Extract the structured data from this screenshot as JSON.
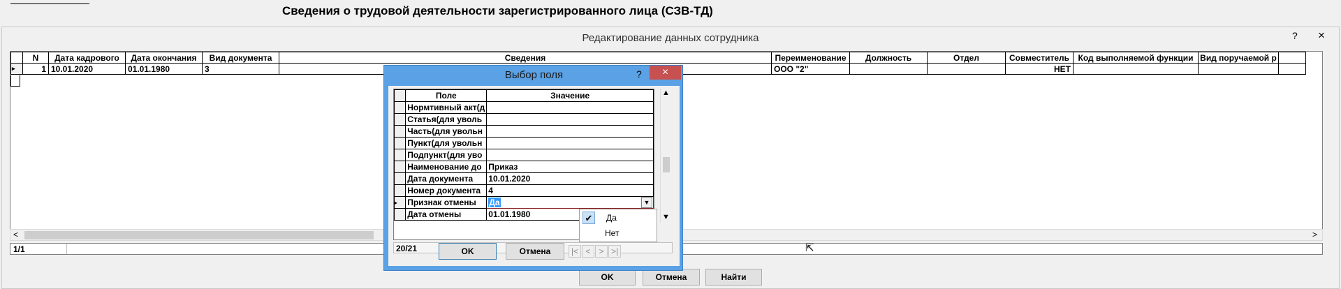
{
  "header": {
    "title": "Сведения о трудовой деятельности зарегистрированного лица (СЗВ-ТД)"
  },
  "window": {
    "title": "Редактирование данных сотрудника",
    "help": "?",
    "close": "×"
  },
  "grid": {
    "columns": [
      "N",
      "Дата кадрового",
      "Дата окончания",
      "Вид документа",
      "Сведения",
      "Переименование",
      "Должность",
      "Отдел",
      "Совместитель",
      "Код выполняемой функции",
      "Вид поручаемой р"
    ],
    "rows": [
      {
        "indicator": "▸",
        "cells": [
          "1",
          "10.01.2020",
          "01.01.1980",
          "3",
          "",
          "ООО \"2\"",
          "",
          "",
          "НЕТ",
          "",
          ""
        ]
      }
    ],
    "counter": "1/1",
    "scroll_left": "<",
    "scroll_right": ">"
  },
  "buttons": {
    "ok": "OK",
    "cancel": "Отмена",
    "find": "Найти"
  },
  "dialog": {
    "title": "Выбор поля",
    "help": "?",
    "close": "×",
    "columns": [
      "Поле",
      "Значение"
    ],
    "rows": [
      {
        "field": "Нормтивный акт(д",
        "value": ""
      },
      {
        "field": "Статья(для уволь",
        "value": ""
      },
      {
        "field": "Часть(для увольн",
        "value": ""
      },
      {
        "field": "Пункт(для увольн",
        "value": ""
      },
      {
        "field": "Подпункт(для уво",
        "value": ""
      },
      {
        "field": "Наименование до",
        "value": "Приказ"
      },
      {
        "field": "Дата документа",
        "value": "10.01.2020"
      },
      {
        "field": "Номер документа",
        "value": "4"
      },
      {
        "field": "Признак отмены",
        "value": "Да",
        "selected": true
      },
      {
        "field": "Дата отмены",
        "value": "01.01.1980"
      }
    ],
    "counter": "20/21",
    "ok": "OK",
    "cancel": "Отмена",
    "nav": [
      "|<",
      "<",
      ">",
      ">|"
    ]
  },
  "popup": {
    "options": [
      "Да",
      "Нет"
    ],
    "checked": "Да"
  }
}
